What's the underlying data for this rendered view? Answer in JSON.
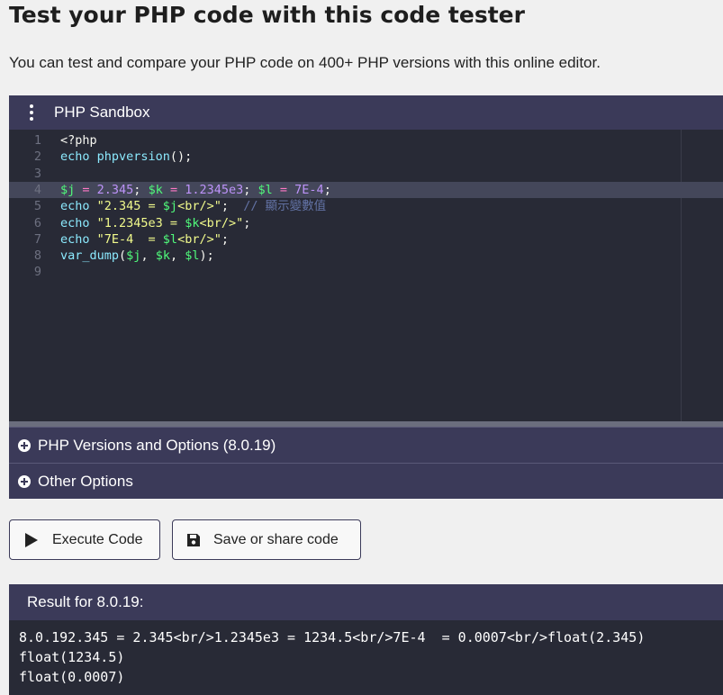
{
  "page": {
    "title": "Test your PHP code with this code tester",
    "description": "You can test and compare your PHP code on 400+ PHP versions with this online editor."
  },
  "sandbox": {
    "title": "PHP Sandbox",
    "menu_icon": "vertical-dots-icon",
    "active_line": 4,
    "lines": [
      {
        "num": "1",
        "tokens": [
          {
            "t": "plain",
            "v": "<?php"
          }
        ]
      },
      {
        "num": "2",
        "tokens": [
          {
            "t": "kw",
            "v": "echo "
          },
          {
            "t": "fn",
            "v": "phpversion"
          },
          {
            "t": "plain",
            "v": "();"
          }
        ]
      },
      {
        "num": "3",
        "tokens": []
      },
      {
        "num": "4",
        "tokens": [
          {
            "t": "var",
            "v": "$j"
          },
          {
            "t": "op",
            "v": " = "
          },
          {
            "t": "num",
            "v": "2.345"
          },
          {
            "t": "plain",
            "v": "; "
          },
          {
            "t": "var",
            "v": "$k"
          },
          {
            "t": "op",
            "v": " = "
          },
          {
            "t": "num",
            "v": "1.2345e3"
          },
          {
            "t": "plain",
            "v": "; "
          },
          {
            "t": "var",
            "v": "$l"
          },
          {
            "t": "op",
            "v": " = "
          },
          {
            "t": "num",
            "v": "7E-4"
          },
          {
            "t": "plain",
            "v": ";"
          }
        ]
      },
      {
        "num": "5",
        "tokens": [
          {
            "t": "kw",
            "v": "echo "
          },
          {
            "t": "str",
            "v": "\"2.345 = "
          },
          {
            "t": "var",
            "v": "$j"
          },
          {
            "t": "str",
            "v": "<br/>\""
          },
          {
            "t": "plain",
            "v": ";  "
          },
          {
            "t": "cmt",
            "v": "// 顯示變數值"
          }
        ]
      },
      {
        "num": "6",
        "tokens": [
          {
            "t": "kw",
            "v": "echo "
          },
          {
            "t": "str",
            "v": "\"1.2345e3 = "
          },
          {
            "t": "var",
            "v": "$k"
          },
          {
            "t": "str",
            "v": "<br/>\""
          },
          {
            "t": "plain",
            "v": ";"
          }
        ]
      },
      {
        "num": "7",
        "tokens": [
          {
            "t": "kw",
            "v": "echo "
          },
          {
            "t": "str",
            "v": "\"7E-4  = "
          },
          {
            "t": "var",
            "v": "$l"
          },
          {
            "t": "str",
            "v": "<br/>\""
          },
          {
            "t": "plain",
            "v": ";"
          }
        ]
      },
      {
        "num": "8",
        "tokens": [
          {
            "t": "fn",
            "v": "var_dump"
          },
          {
            "t": "plain",
            "v": "("
          },
          {
            "t": "var",
            "v": "$j"
          },
          {
            "t": "plain",
            "v": ", "
          },
          {
            "t": "var",
            "v": "$k"
          },
          {
            "t": "plain",
            "v": ", "
          },
          {
            "t": "var",
            "v": "$l"
          },
          {
            "t": "plain",
            "v": ");"
          }
        ]
      },
      {
        "num": "9",
        "tokens": []
      }
    ]
  },
  "options": {
    "versions_label": "PHP Versions and Options (8.0.19)",
    "other_label": "Other Options",
    "icon": "plus-circle-icon"
  },
  "buttons": {
    "execute_label": "Execute Code",
    "execute_icon": "play-icon",
    "save_label": "Save or share code",
    "save_icon": "floppy-disk-icon"
  },
  "result": {
    "header": "Result for 8.0.19:",
    "output": "8.0.192.345 = 2.345<br/>1.2345e3 = 1234.5<br/>7E-4  = 0.0007<br/>float(2.345)\nfloat(1234.5)\nfloat(0.0007)"
  },
  "colors": {
    "panel_header": "#3b3a59",
    "editor_bg": "#282a36",
    "page_bg": "#f0f0f0"
  }
}
